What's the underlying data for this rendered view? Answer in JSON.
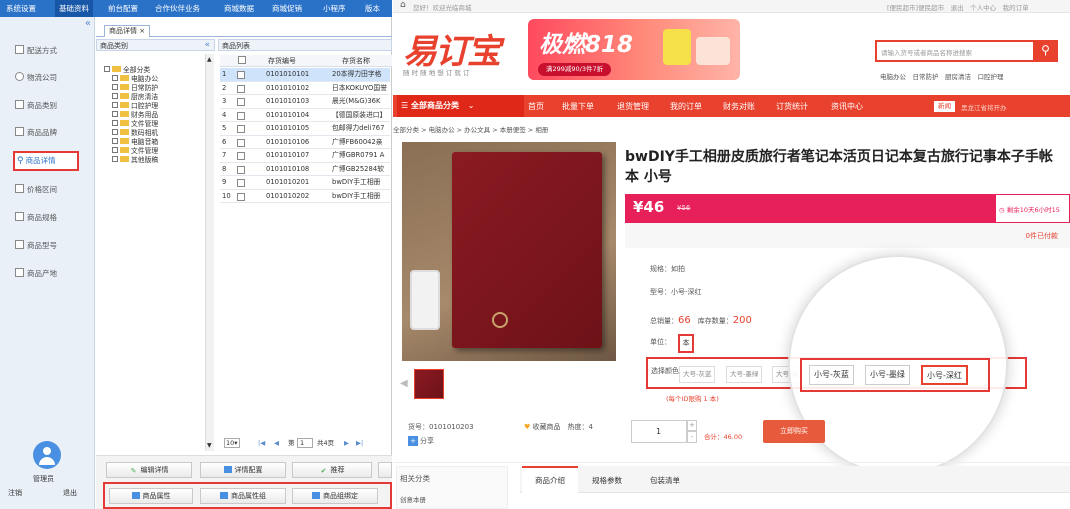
{
  "admin": {
    "topnav": [
      "系统设置",
      "基础资料",
      "前台配置",
      "合作伙伴业务",
      "商城数据",
      "商城促销",
      "小程序",
      "版本"
    ],
    "sidebar_collapse": "«",
    "sidebar": [
      "配送方式",
      "物流公司",
      "商品类别",
      "商品品牌",
      "商品详情",
      "价格区间",
      "商品规格",
      "商品型号",
      "商品产地"
    ],
    "user_label": "管理员",
    "logout_left": "注销",
    "logout_right": "退出",
    "tab": "商品详情 ×",
    "tree_title": "商品类别",
    "tree_collapse": "«",
    "tree": [
      "全部分类",
      "电脑办公",
      "日常防护",
      "厨房清洁",
      "口腔护理",
      "财务用品",
      "文件管理",
      "数码相机",
      "电脑音箱",
      "文件管理",
      "其他版稿"
    ],
    "list_title": "商品列表",
    "cols": {
      "code": "存货编号",
      "name": "存货名称"
    },
    "rows": [
      {
        "no": "1",
        "code": "0101010101",
        "name": "20本得力田字格"
      },
      {
        "no": "2",
        "code": "0101010102",
        "name": "日本KOKUYO国誉"
      },
      {
        "no": "3",
        "code": "0101010103",
        "name": "晨光(M&G)36K"
      },
      {
        "no": "4",
        "code": "0101010104",
        "name": "【德国原装进口】"
      },
      {
        "no": "5",
        "code": "0101010105",
        "name": "包邮得力deli767"
      },
      {
        "no": "6",
        "code": "0101010106",
        "name": "广博FB60042亲"
      },
      {
        "no": "7",
        "code": "0101010107",
        "name": "广博GBR0791 A"
      },
      {
        "no": "8",
        "code": "0101010108",
        "name": "广博GB25284软"
      },
      {
        "no": "9",
        "code": "0101010201",
        "name": "bwDIY手工相册"
      },
      {
        "no": "10",
        "code": "0101010202",
        "name": "bwDIY手工相册"
      }
    ],
    "pager": {
      "size": "10",
      "page_label": "第",
      "page": "1",
      "total": "共4页"
    },
    "buttons": [
      "编辑详情",
      "详情配置",
      "推荐",
      "商品属性",
      "商品属性组",
      "商品组绑定"
    ]
  },
  "shop": {
    "topbar": {
      "welcome": "您好！欢迎光临商城",
      "right": "[便民超市]便民超市　退出　个人中心　我的订单"
    },
    "logo": "易订宝",
    "slogan": "随 时 随 地 想 订 就 订",
    "banner": {
      "title": "极燃818",
      "sub": "满299减90/3件7折"
    },
    "search": {
      "placeholder": "请输入货号或者商品名称进搜索",
      "hot": "电脑办公　日常防护　厨房清洁　口腔护理"
    },
    "nav": {
      "all": "全部商品分类",
      "items": [
        "首页",
        "批量下单",
        "退货管理",
        "我的订单",
        "财务对账",
        "订货统计",
        "资讯中心"
      ],
      "news_badge": "新闻",
      "news_text": "黑龙江省将开办"
    },
    "breadcrumb": "全部分类 > 电脑办公 > 办公文具 > 本册便签 > 相册",
    "product": {
      "title": "bwDIY手工相册皮质旅行者笔记本活页日记本复古旅行记事本子手帐本 小号",
      "price": "¥46",
      "old_price": "¥56",
      "countdown": "剩余10天6小时15",
      "sold": "0件已付款",
      "spec_label": "规格：",
      "spec": "如拍",
      "model_label": "型号：",
      "model": "小号-深红",
      "sales_label": "总销量：",
      "sales": "66",
      "stock_label": "库存数量：",
      "stock": "200",
      "unit_label": "单位：",
      "unit": "本",
      "color_label": "选择颜色",
      "colors_small": [
        "大号-灰蓝",
        "大号-墨绿",
        "大号-深"
      ],
      "colors_big": [
        "小号-灰蓝",
        "小号-墨绿",
        "小号-深红"
      ],
      "limit": "(每个ID限购 1 本)",
      "sku": "货号：0101010203",
      "fav": "收藏商品",
      "hot": "热度：4",
      "share": "分享",
      "qty": "1",
      "total_label": "合计：",
      "total": "46.00",
      "buy": "立即购买"
    },
    "tabs": {
      "related": "相关分类",
      "related_item": "创意本册",
      "items": [
        "商品介绍",
        "规格参数",
        "包装清单"
      ]
    }
  },
  "colors": {
    "admin_blue": "#2a72c8",
    "shop_red": "#e8412d",
    "price_bar": "#e8205a",
    "highlight": "#e53935"
  }
}
